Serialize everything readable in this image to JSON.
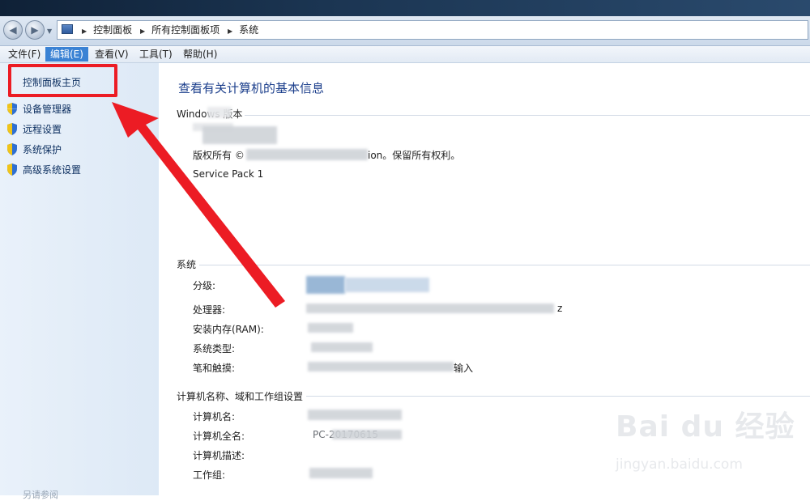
{
  "address_bar": {
    "breadcrumbs": [
      "控制面板",
      "所有控制面板项",
      "系统"
    ]
  },
  "menu": {
    "items": [
      "文件(F)",
      "编辑(E)",
      "查看(V)",
      "工具(T)",
      "帮助(H)"
    ],
    "selected": "编辑(E)"
  },
  "left_nav": {
    "home": "控制面板主页",
    "links": [
      "设备管理器",
      "远程设置",
      "系统保护",
      "高级系统设置"
    ],
    "see_also": "另请参阅"
  },
  "main": {
    "title": "查看有关计算机的基本信息",
    "windows_edition": {
      "label": "Windows 版本",
      "copyright_prefix": "版权所有 ©",
      "copyright_suffix": "ion。保留所有权利。",
      "service_pack": "Service Pack 1"
    },
    "system": {
      "label": "系统",
      "rows": [
        "分级:",
        "处理器:",
        "安装内存(RAM):",
        "系统类型:",
        "笔和触摸:"
      ],
      "processor_suffix": "z",
      "pen_suffix": "输入"
    },
    "computer_name": {
      "label": "计算机名称、域和工作组设置",
      "rows": [
        "计算机名:",
        "计算机全名:",
        "计算机描述:",
        "工作组:"
      ],
      "full_name_partial": "PC-20170615"
    }
  },
  "watermark": {
    "logo": "Bai du 经验",
    "url": "jingyan.baidu.com"
  },
  "colors": {
    "highlight_red": "#ec1c24",
    "title_blue": "#1c3f8c",
    "menu_selected": "#3a82d4"
  }
}
